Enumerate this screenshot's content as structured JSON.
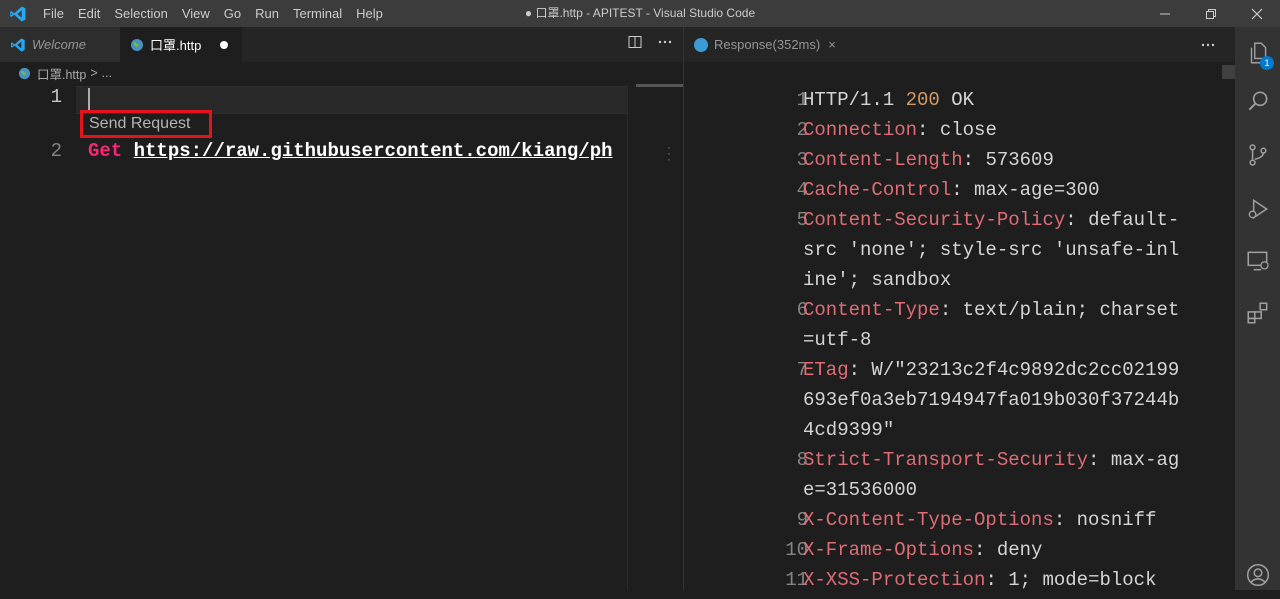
{
  "window": {
    "title": "● 口罩.http - APITEST - Visual Studio Code",
    "menu": [
      "File",
      "Edit",
      "Selection",
      "View",
      "Go",
      "Run",
      "Terminal",
      "Help"
    ]
  },
  "left_editor": {
    "tabs": [
      {
        "label": "Welcome",
        "active": false,
        "italic": true
      },
      {
        "label": "口罩.http",
        "active": true,
        "dirty": true
      }
    ],
    "breadcrumb": {
      "file": "口罩.http",
      "separator": ">",
      "rest": "..."
    },
    "line_numbers": [
      "1",
      "2"
    ],
    "codelens": "Send Request",
    "code": {
      "method": "Get",
      "url": "https://raw.githubusercontent.com/kiang/ph"
    }
  },
  "response_panel": {
    "tab_label": "Response(352ms)",
    "close_glyph": "×",
    "more_glyph": "···",
    "lines": [
      {
        "n": "1",
        "key": "",
        "sep": "",
        "value": "HTTP/1.1 ",
        "status": "200",
        "tail": " OK"
      },
      {
        "n": "2",
        "key": "Connection",
        "sep": ": ",
        "value": "close"
      },
      {
        "n": "3",
        "key": "Content-Length",
        "sep": ": ",
        "value": "573609"
      },
      {
        "n": "4",
        "key": "Cache-Control",
        "sep": ": ",
        "value": "max-age=300"
      },
      {
        "n": "5",
        "key": "Content-Security-Policy",
        "sep": ": ",
        "value": "default-"
      },
      {
        "n": "",
        "key": "",
        "sep": "",
        "value": "src 'none'; style-src 'unsafe-inl"
      },
      {
        "n": "",
        "key": "",
        "sep": "",
        "value": "ine'; sandbox"
      },
      {
        "n": "6",
        "key": "Content-Type",
        "sep": ": ",
        "value": "text/plain; charset"
      },
      {
        "n": "",
        "key": "",
        "sep": "",
        "value": "=utf-8"
      },
      {
        "n": "7",
        "key": "ETag",
        "sep": ": ",
        "value": "W/\"23213c2f4c9892dc2cc02199"
      },
      {
        "n": "",
        "key": "",
        "sep": "",
        "value": "693ef0a3eb7194947fa019b030f37244b"
      },
      {
        "n": "",
        "key": "",
        "sep": "",
        "value": "4cd9399\""
      },
      {
        "n": "8",
        "key": "Strict-Transport-Security",
        "sep": ": ",
        "value": "max-ag"
      },
      {
        "n": "",
        "key": "",
        "sep": "",
        "value": "e=31536000"
      },
      {
        "n": "9",
        "key": "X-Content-Type-Options",
        "sep": ": ",
        "value": "nosniff"
      },
      {
        "n": "10",
        "key": "X-Frame-Options",
        "sep": ": ",
        "value": "deny"
      },
      {
        "n": "11",
        "key": "X-XSS-Protection",
        "sep": ": ",
        "value": "1; mode=block"
      }
    ]
  },
  "activity_bar": {
    "explorer_badge": "1",
    "items": [
      "files-icon",
      "search-icon",
      "source-control-icon",
      "run-debug-icon",
      "remote-explorer-icon",
      "extensions-icon",
      "account-icon"
    ]
  },
  "colors": {
    "title_bar": "#3c3c3c",
    "editor_bg": "#1e1e1e",
    "tab_bar": "#252526",
    "activity_bar": "#333333",
    "highlight_box": "#e3141c",
    "header_key": "#e06c75",
    "status_code": "#d19a66",
    "get_keyword": "#f92672",
    "badge": "#007acc"
  }
}
